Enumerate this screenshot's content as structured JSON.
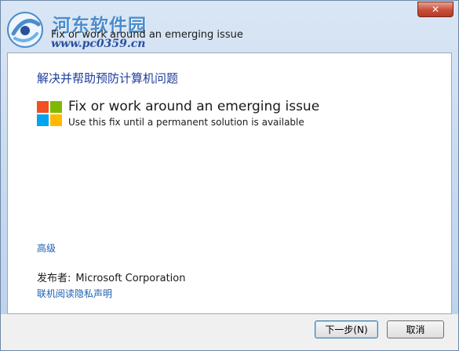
{
  "window": {
    "title": "Fix or work around an emerging issue",
    "close_symbol": "✕"
  },
  "watermark": {
    "site_name": "河东软件园",
    "url": "www.pc0359.cn"
  },
  "content": {
    "heading": "解决并帮助预防计算机问题",
    "option": {
      "icon": "windows-logo-icon",
      "title": "Fix or work around an emerging issue",
      "description": "Use this fix until a permanent solution is available"
    },
    "advanced_link": "高级",
    "publisher_label": "发布者:",
    "publisher_value": "Microsoft Corporation",
    "privacy_link": "联机阅读隐私声明"
  },
  "footer": {
    "next_label": "下一步(N)",
    "cancel_label": "取消"
  },
  "colors": {
    "heading": "#1f3d9b",
    "link": "#1a5fb4",
    "logo_red": "#f25022",
    "logo_green": "#7fba00",
    "logo_blue": "#00a4ef",
    "logo_yellow": "#ffb900"
  }
}
